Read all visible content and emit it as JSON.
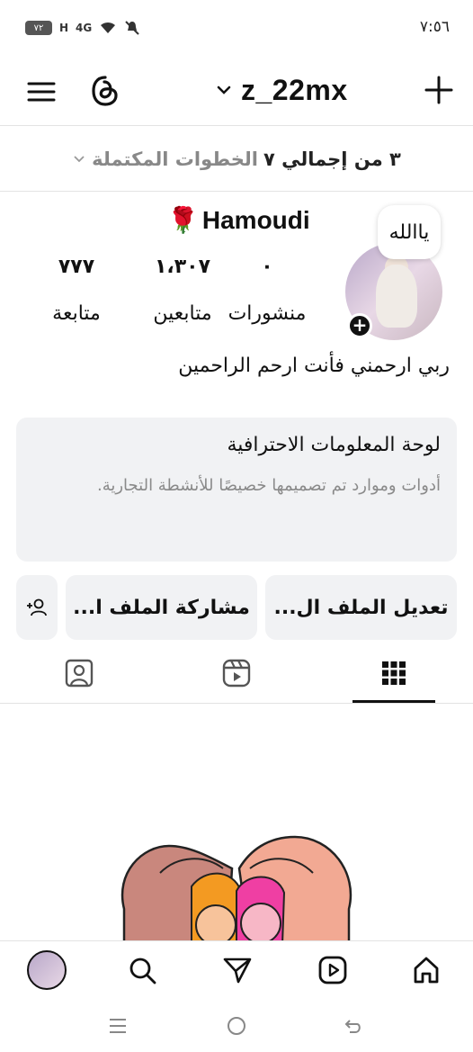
{
  "status_bar": {
    "time": "٧:٥٦",
    "battery": "٧٢",
    "signal_1": "H",
    "signal_2": "4G"
  },
  "top_nav": {
    "username": "z_22mx"
  },
  "steps": {
    "bold_part": "٣ من إجمالي ٧",
    "light_part": "الخطوات المكتملة"
  },
  "profile": {
    "display_name": "Hamoudi",
    "name_emoji": "🌹",
    "note": "ياالله",
    "stats": {
      "posts_count": "٠",
      "posts_label": "منشورات",
      "followers_count": "١،٣٠٧",
      "followers_label": "متابعين",
      "following_count": "٧٧٧",
      "following_label": "متابعة"
    },
    "bio": "ربي ارحمني فأنت ارحم الراحمين"
  },
  "dashboard": {
    "title": "لوحة المعلومات الاحترافية",
    "description": "أدوات وموارد تم تصميمها خصيصًا للأنشطة التجارية."
  },
  "actions": {
    "edit_label": "تعديل الملف ال...",
    "share_label": "مشاركة الملف ا..."
  },
  "icons": {
    "menu": "hamburger-icon",
    "threads": "threads-icon",
    "dropdown": "chevron-down-icon",
    "create": "plus-icon",
    "grid": "grid-icon",
    "reels": "reels-icon",
    "tagged": "tagged-icon",
    "home": "home-icon",
    "search": "search-icon",
    "messages": "send-icon",
    "add_person": "add-person-icon"
  },
  "colors": {
    "text": "#111111",
    "muted": "#8a8a8a",
    "card_bg": "#f1f2f4",
    "divider": "#e3e3e3"
  }
}
